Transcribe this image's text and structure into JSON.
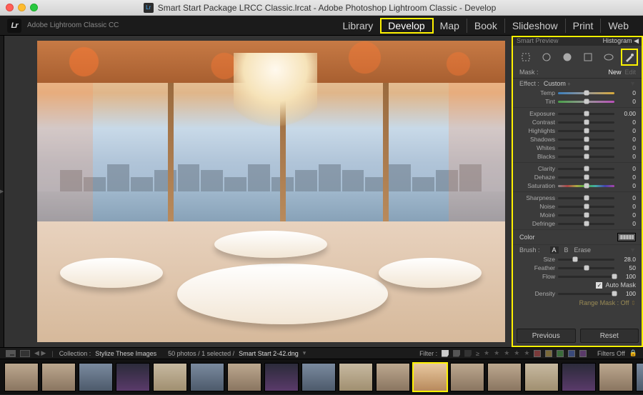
{
  "window": {
    "title": "Smart Start Package LRCC Classic.lrcat - Adobe Photoshop Lightroom Classic - Develop"
  },
  "header": {
    "logo_text": "Adobe Lightroom Classic CC",
    "modules": [
      "Library",
      "Develop",
      "Map",
      "Book",
      "Slideshow",
      "Print",
      "Web"
    ],
    "active": "Develop"
  },
  "right_panel": {
    "smart_preview": "Smart Preview",
    "histogram": "Histogram",
    "tools": [
      "crop-icon",
      "spot-icon",
      "redeye-icon",
      "gradient-icon",
      "radial-icon",
      "brush-icon"
    ],
    "mask": {
      "label": "Mask :",
      "new": "New",
      "edit": "Edit"
    },
    "effect": {
      "label": "Effect :",
      "value": "Custom"
    },
    "sliders": {
      "temp": {
        "label": "Temp",
        "value": "0",
        "pos": 50,
        "track": "temp"
      },
      "tint": {
        "label": "Tint",
        "value": "0",
        "pos": 50,
        "track": "tint"
      },
      "exposure": {
        "label": "Exposure",
        "value": "0.00",
        "pos": 50
      },
      "contrast": {
        "label": "Contrast",
        "value": "0",
        "pos": 50
      },
      "highlights": {
        "label": "Highlights",
        "value": "0",
        "pos": 50
      },
      "shadows": {
        "label": "Shadows",
        "value": "0",
        "pos": 50
      },
      "whites": {
        "label": "Whites",
        "value": "0",
        "pos": 50
      },
      "blacks": {
        "label": "Blacks",
        "value": "0",
        "pos": 50
      },
      "clarity": {
        "label": "Clarity",
        "value": "0",
        "pos": 50
      },
      "dehaze": {
        "label": "Dehaze",
        "value": "0",
        "pos": 50
      },
      "saturation": {
        "label": "Saturation",
        "value": "0",
        "pos": 50,
        "track": "sat"
      },
      "sharpness": {
        "label": "Sharpness",
        "value": "0",
        "pos": 50
      },
      "noise": {
        "label": "Noise",
        "value": "0",
        "pos": 50
      },
      "moire": {
        "label": "Moiré",
        "value": "0",
        "pos": 50
      },
      "defringe": {
        "label": "Defringe",
        "value": "0",
        "pos": 50
      },
      "size": {
        "label": "Size",
        "value": "28.0",
        "pos": 30
      },
      "feather": {
        "label": "Feather",
        "value": "50",
        "pos": 50
      },
      "flow": {
        "label": "Flow",
        "value": "100",
        "pos": 100
      },
      "density": {
        "label": "Density",
        "value": "100",
        "pos": 100
      }
    },
    "color_label": "Color",
    "brush": {
      "label": "Brush :",
      "a": "A",
      "b": "B",
      "erase": "Erase"
    },
    "automask": {
      "checked": true,
      "label": "Auto Mask"
    },
    "range_mask": "Range Mask : Off",
    "buttons": {
      "previous": "Previous",
      "reset": "Reset"
    }
  },
  "filmstrip": {
    "collection_label": "Collection :",
    "collection_name": "Stylize These Images",
    "count": "50 photos / 1 selected /",
    "filename": "Smart Start 2-42.dng",
    "filter_label": "Filter :",
    "filters_off": "Filters Off",
    "thumb_count": 18,
    "selected_index": 11
  }
}
